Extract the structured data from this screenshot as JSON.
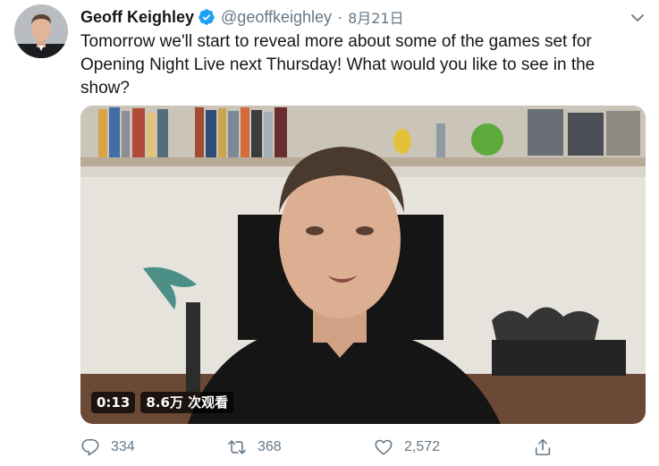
{
  "tweet": {
    "display_name": "Geoff Keighley",
    "handle": "@geoffkeighley",
    "separator": "·",
    "date": "8月21日",
    "text": "Tomorrow we'll start to reveal more about some of the games set for Opening Night Live next Thursday! What would you like to see in the show?",
    "verified": true
  },
  "video": {
    "time": "0:13",
    "views": "8.6万 次观看"
  },
  "actions": {
    "reply_count": "334",
    "retweet_count": "368",
    "like_count": "2,572"
  },
  "icons": {
    "verified": "verified-badge-icon",
    "caret": "chevron-down-icon",
    "reply": "reply-icon",
    "retweet": "retweet-icon",
    "like": "heart-icon",
    "share": "share-icon"
  },
  "colors": {
    "text": "#14171a",
    "secondary": "#657786",
    "verified_blue": "#1da1f2"
  }
}
